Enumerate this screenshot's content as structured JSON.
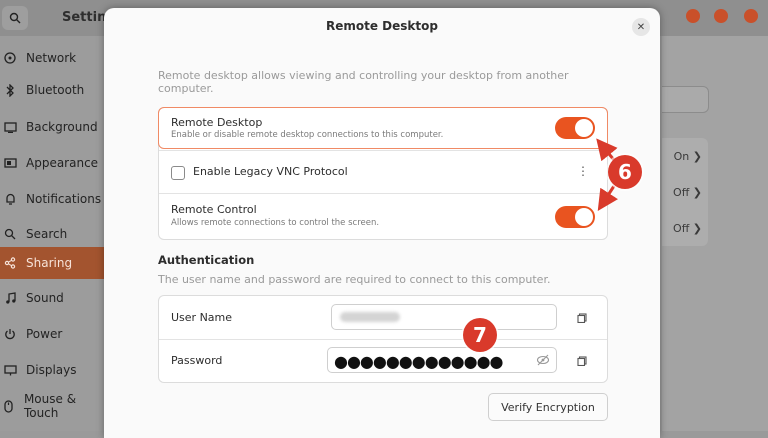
{
  "background_window": {
    "title": "Settings",
    "sidebar": [
      {
        "label": "Network",
        "icon": "network-icon"
      },
      {
        "label": "Bluetooth",
        "icon": "bluetooth-icon"
      },
      {
        "label": "Background",
        "icon": "background-icon"
      },
      {
        "label": "Appearance",
        "icon": "appearance-icon"
      },
      {
        "label": "Notifications",
        "icon": "bell-icon"
      },
      {
        "label": "Search",
        "icon": "search-icon"
      },
      {
        "label": "Sharing",
        "icon": "share-icon",
        "active": true
      },
      {
        "label": "Sound",
        "icon": "music-note-icon"
      },
      {
        "label": "Power",
        "icon": "power-icon"
      },
      {
        "label": "Displays",
        "icon": "display-icon"
      },
      {
        "label": "Mouse & Touch",
        "icon": "mouse-icon"
      }
    ],
    "list_values": [
      "On",
      "Off",
      "Off"
    ]
  },
  "dialog": {
    "title": "Remote Desktop",
    "description": "Remote desktop allows viewing and controlling your desktop from another computer.",
    "rows": {
      "remote_desktop": {
        "title": "Remote Desktop",
        "subtitle": "Enable or disable remote desktop connections to this computer.",
        "enabled": true
      },
      "legacy_vnc": {
        "title": "Enable Legacy VNC Protocol",
        "checked": false
      },
      "remote_control": {
        "title": "Remote Control",
        "subtitle": "Allows remote connections to control the screen.",
        "enabled": true
      }
    },
    "authentication": {
      "heading": "Authentication",
      "description": "The user name and password are required to connect to this computer.",
      "username_label": "User Name",
      "password_label": "Password",
      "password_mask": "●●●●●●●●●●●●●",
      "verify_button": "Verify Encryption"
    }
  },
  "annotations": {
    "callout_6": "6",
    "callout_7": "7"
  },
  "colors": {
    "accent": "#e95420",
    "callout": "#d93a2b",
    "sidebar_active": "#a3542f"
  }
}
